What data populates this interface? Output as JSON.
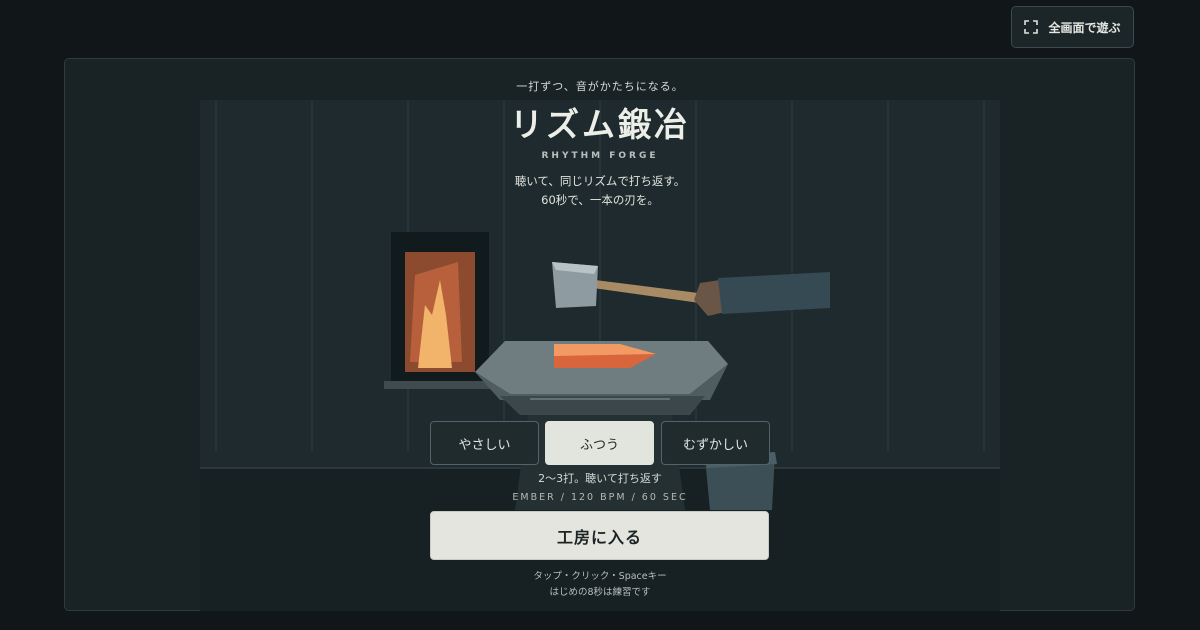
{
  "fullscreen": {
    "label": "全画面で遊ぶ",
    "icon": "fullscreen-icon"
  },
  "header": {
    "tagline": "一打ずつ、音がかたちになる。",
    "title": "リズム鍛冶",
    "subtitle": "RHYTHM FORGE",
    "desc_line1": "聴いて、同じリズムで打ち返す。",
    "desc_line2": "60秒で、一本の刃を。"
  },
  "difficulty": {
    "options": [
      "やさしい",
      "ふつう",
      "むずかしい"
    ],
    "selected": "ふつう",
    "hint": "2〜3打。聴いて打ち返す",
    "meta": "EMBER / 120 BPM / 60 SEC"
  },
  "enter_button": {
    "label": "工房に入る"
  },
  "footer": {
    "line1": "タップ・クリック・Spaceキー",
    "line2": "はじめの8秒は練習です"
  },
  "colors": {
    "background": "#111719",
    "panel": "#192325",
    "stage": "#1e2a2d",
    "button_selected": "#e2e5dd",
    "ember": "#e8774a",
    "flame": "#f2b46a"
  }
}
